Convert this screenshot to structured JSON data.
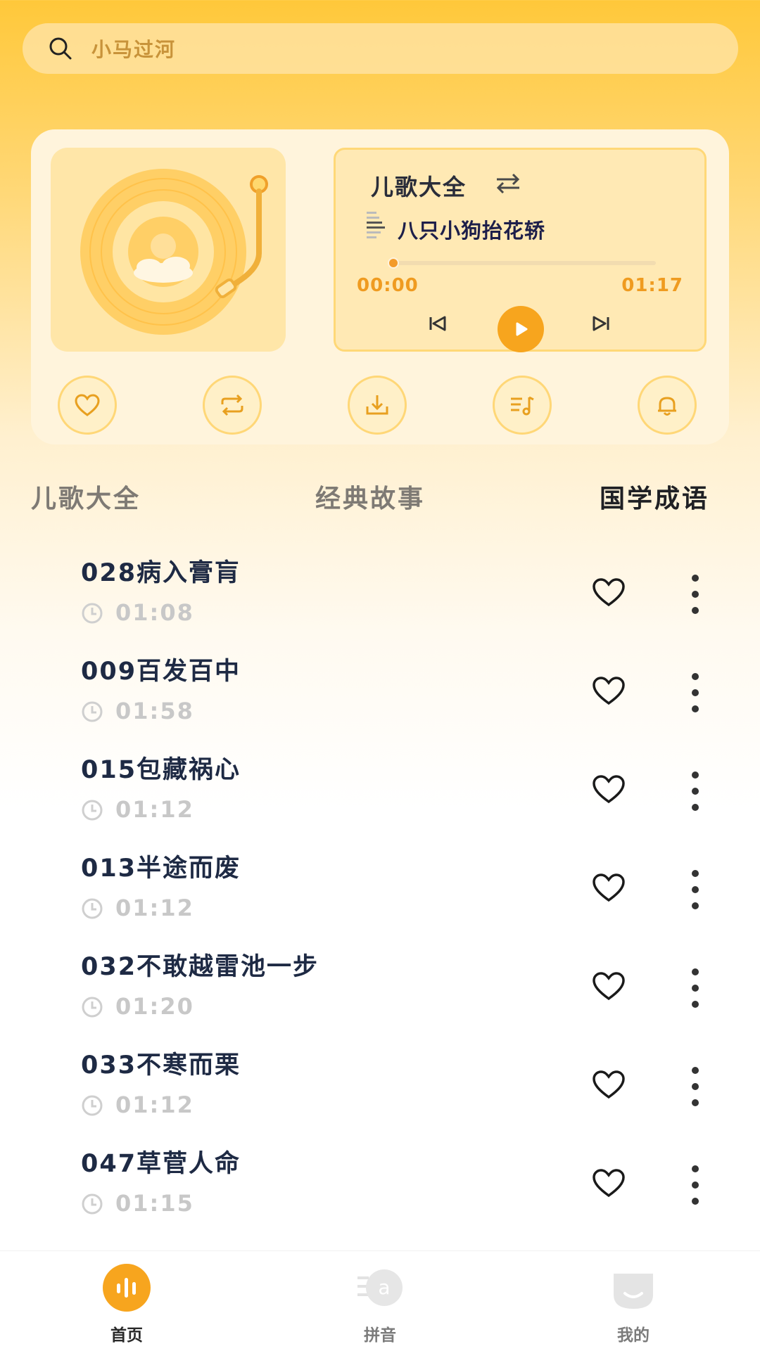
{
  "search": {
    "placeholder": "小马过河",
    "icon": "search-icon"
  },
  "player": {
    "category_title": "儿歌大全",
    "song_name": "八只小狗抬花轿",
    "current_time": "00:00",
    "total_time": "01:17",
    "progress": 0.0,
    "icons": {
      "shuffle": "shuffle-icon",
      "prev": "previous-icon",
      "play": "play-icon",
      "next": "next-icon"
    },
    "actions": [
      "heart-icon",
      "repeat-icon",
      "download-icon",
      "playlist-icon",
      "bell-icon"
    ]
  },
  "tabs": [
    {
      "label": "儿歌大全",
      "active": false
    },
    {
      "label": "经典故事",
      "active": false
    },
    {
      "label": "国学成语",
      "active": true
    }
  ],
  "songs": [
    {
      "title": "028病入膏肓",
      "duration": "01:08"
    },
    {
      "title": "009百发百中",
      "duration": "01:58"
    },
    {
      "title": "015包藏祸心",
      "duration": "01:12"
    },
    {
      "title": "013半途而废",
      "duration": "01:12"
    },
    {
      "title": "032不敢越雷池一步",
      "duration": "01:20"
    },
    {
      "title": "033不寒而栗",
      "duration": "01:12"
    },
    {
      "title": "047草菅人命",
      "duration": "01:15"
    }
  ],
  "nav": [
    {
      "label": "首页",
      "active": true
    },
    {
      "label": "拼音",
      "active": false
    },
    {
      "label": "我的",
      "active": false
    }
  ],
  "colors": {
    "accent": "#f7a51e",
    "accent_light": "#ffd877",
    "text_dark": "#1e2a44"
  }
}
